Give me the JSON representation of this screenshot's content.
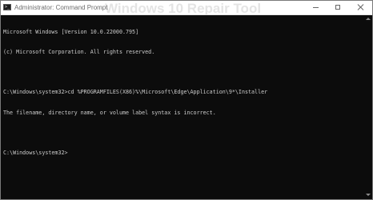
{
  "window": {
    "title": "Administrator: Command Prompt",
    "app_icon": "command-prompt-icon",
    "background_ghost_text": "Windows 10 Repair Tool",
    "controls": {
      "minimize_icon": "minimize-icon",
      "maximize_icon": "maximize-icon",
      "close_icon": "close-icon"
    }
  },
  "console": {
    "lines": [
      "Microsoft Windows [Version 10.0.22000.795]",
      "(c) Microsoft Corporation. All rights reserved.",
      "",
      "C:\\Windows\\system32>cd %PROGRAMFILES(X86)%\\Microsoft\\Edge\\Application\\9*\\Installer",
      "The filename, directory name, or volume label syntax is incorrect.",
      "",
      "C:\\Windows\\system32>"
    ],
    "text_color": "#cccccc",
    "background_color": "#0c0c0c"
  }
}
